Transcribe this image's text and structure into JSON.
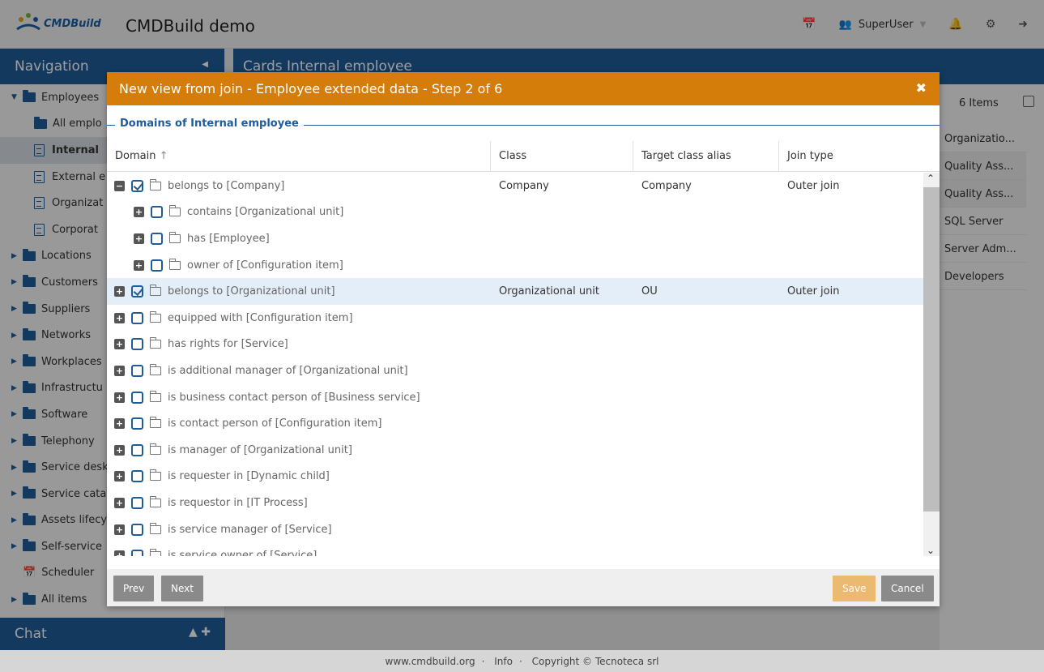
{
  "header": {
    "logo_text": "CMDBuild",
    "app_title": "CMDBuild demo",
    "user": "SuperUser"
  },
  "navigation": {
    "title": "Navigation",
    "items": [
      {
        "label": "Employees",
        "type": "folder-open"
      },
      {
        "label": "All emplo",
        "type": "folder-sub"
      },
      {
        "label": "Internal",
        "type": "doc"
      },
      {
        "label": "External e",
        "type": "doc"
      },
      {
        "label": "Organizat",
        "type": "doc"
      },
      {
        "label": "Corporat",
        "type": "doc"
      },
      {
        "label": "Locations",
        "type": "folder"
      },
      {
        "label": "Customers",
        "type": "folder"
      },
      {
        "label": "Suppliers",
        "type": "folder"
      },
      {
        "label": "Networks",
        "type": "folder"
      },
      {
        "label": "Workplaces",
        "type": "folder"
      },
      {
        "label": "Infrastructu",
        "type": "folder"
      },
      {
        "label": "Software",
        "type": "folder"
      },
      {
        "label": "Telephony",
        "type": "folder"
      },
      {
        "label": "Service desk",
        "type": "folder"
      },
      {
        "label": "Service cata",
        "type": "folder"
      },
      {
        "label": "Assets lifecy",
        "type": "folder"
      },
      {
        "label": "Self-service",
        "type": "folder"
      },
      {
        "label": "Scheduler",
        "type": "calendar"
      },
      {
        "label": "All items",
        "type": "folder"
      }
    ],
    "chat_title": "Chat"
  },
  "main": {
    "title": "Cards Internal employee",
    "items_count": "6 Items",
    "right_rows": [
      "Organizatio...",
      "Quality Ass...",
      "Quality Ass...",
      "SQL Server",
      "Server Adm...",
      "Developers"
    ]
  },
  "modal": {
    "title": "New view from join - Employee extended data - Step 2 of 6",
    "fieldset_legend": "Domains of Internal employee",
    "columns": [
      "Domain",
      "Class",
      "Target class alias",
      "Join type"
    ],
    "rows": [
      {
        "label": "belongs to [Company]",
        "level": 0,
        "expanded": true,
        "checked": true,
        "open": true,
        "class": "Company",
        "alias": "Company",
        "join": "Outer join",
        "selected": false
      },
      {
        "label": "contains [Organizational unit]",
        "level": 1,
        "expanded": false,
        "checked": false,
        "open": false,
        "class": "",
        "alias": "",
        "join": "",
        "selected": false
      },
      {
        "label": "has [Employee]",
        "level": 1,
        "expanded": false,
        "checked": false,
        "open": false,
        "class": "",
        "alias": "",
        "join": "",
        "selected": false
      },
      {
        "label": "owner of [Configuration item]",
        "level": 1,
        "expanded": false,
        "checked": false,
        "open": false,
        "class": "",
        "alias": "",
        "join": "",
        "selected": false
      },
      {
        "label": "belongs to [Organizational unit]",
        "level": 0,
        "expanded": false,
        "checked": true,
        "open": false,
        "class": "Organizational unit",
        "alias": "OU",
        "join": "Outer join",
        "selected": true
      },
      {
        "label": "equipped with [Configuration item]",
        "level": 0,
        "expanded": false,
        "checked": false,
        "open": false,
        "class": "",
        "alias": "",
        "join": "",
        "selected": false
      },
      {
        "label": "has rights for [Service]",
        "level": 0,
        "expanded": false,
        "checked": false,
        "open": false,
        "class": "",
        "alias": "",
        "join": "",
        "selected": false
      },
      {
        "label": "is additional manager of [Organizational unit]",
        "level": 0,
        "expanded": false,
        "checked": false,
        "open": false,
        "class": "",
        "alias": "",
        "join": "",
        "selected": false
      },
      {
        "label": "is business contact person of [Business service]",
        "level": 0,
        "expanded": false,
        "checked": false,
        "open": false,
        "class": "",
        "alias": "",
        "join": "",
        "selected": false
      },
      {
        "label": "is contact person of [Configuration item]",
        "level": 0,
        "expanded": false,
        "checked": false,
        "open": false,
        "class": "",
        "alias": "",
        "join": "",
        "selected": false
      },
      {
        "label": "is manager of [Organizational unit]",
        "level": 0,
        "expanded": false,
        "checked": false,
        "open": false,
        "class": "",
        "alias": "",
        "join": "",
        "selected": false
      },
      {
        "label": "is requester in [Dynamic child]",
        "level": 0,
        "expanded": false,
        "checked": false,
        "open": false,
        "class": "",
        "alias": "",
        "join": "",
        "selected": false
      },
      {
        "label": "is requestor in [IT Process]",
        "level": 0,
        "expanded": false,
        "checked": false,
        "open": false,
        "class": "",
        "alias": "",
        "join": "",
        "selected": false
      },
      {
        "label": "is service manager of [Service]",
        "level": 0,
        "expanded": false,
        "checked": false,
        "open": false,
        "class": "",
        "alias": "",
        "join": "",
        "selected": false
      },
      {
        "label": "is service owner of [Service]",
        "level": 0,
        "expanded": false,
        "checked": false,
        "open": false,
        "class": "",
        "alias": "",
        "join": "",
        "selected": false
      }
    ],
    "buttons": {
      "prev": "Prev",
      "next": "Next",
      "save": "Save",
      "cancel": "Cancel"
    }
  },
  "footer": {
    "site": "www.cmdbuild.org",
    "info": "Info",
    "copyright": "Copyright © Tecnoteca srl"
  },
  "colors": {
    "primary": "#1f5c99",
    "modal_title": "#d57d0b",
    "save_button": "#ebb970"
  }
}
